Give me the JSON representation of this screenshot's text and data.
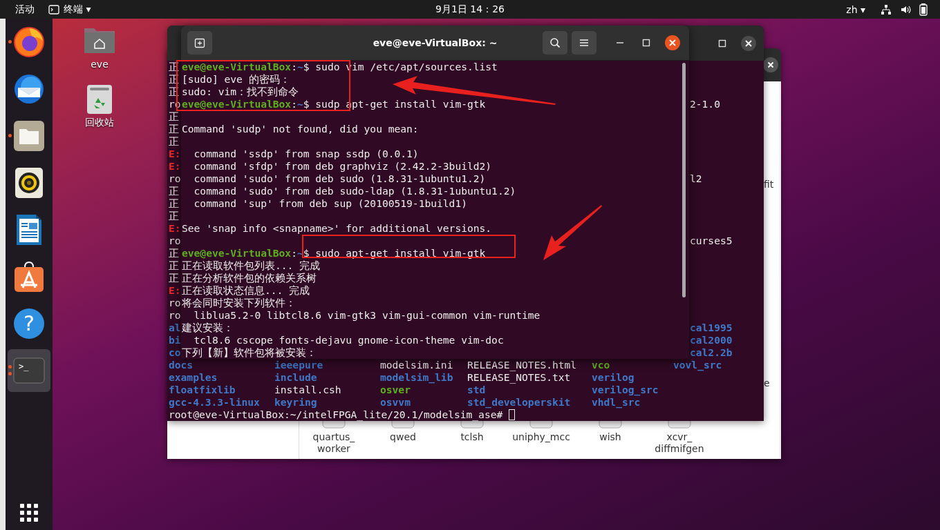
{
  "top_bar": {
    "activities": "活动",
    "app_menu": "终端",
    "app_menu_caret": "▾",
    "clock": "9月1日 14：26",
    "input_source": "zh",
    "input_source_caret": "▾"
  },
  "dock": {
    "items": [
      {
        "kind": "browser",
        "running": true,
        "multiple": false,
        "focused": false
      },
      {
        "kind": "mail",
        "running": false,
        "multiple": false,
        "focused": false
      },
      {
        "kind": "files",
        "running": true,
        "multiple": false,
        "focused": false
      },
      {
        "kind": "music",
        "running": false,
        "multiple": false,
        "focused": false
      },
      {
        "kind": "writer",
        "running": false,
        "multiple": false,
        "focused": false
      },
      {
        "kind": "software",
        "running": false,
        "multiple": false,
        "focused": false
      },
      {
        "kind": "help",
        "glyph": "?",
        "running": false,
        "multiple": false,
        "focused": false
      },
      {
        "kind": "terminal",
        "glyph": ">_",
        "running": true,
        "multiple": true,
        "focused": true
      }
    ]
  },
  "desktop_icons": [
    {
      "kind": "home",
      "label": "eve"
    },
    {
      "kind": "trash",
      "label": "回收站"
    }
  ],
  "file_manager": {
    "fragments": [
      "fit",
      "e"
    ],
    "items": [
      {
        "label": [
          "quartus_",
          "worker"
        ]
      },
      {
        "label": [
          "qwed"
        ]
      },
      {
        "label": [
          "tclsh"
        ]
      },
      {
        "label": [
          "uniphy_mcc"
        ]
      },
      {
        "label": [
          "wish"
        ]
      },
      {
        "label": [
          "xcvr_",
          "diffmifgen"
        ]
      }
    ]
  },
  "back_terminal": {
    "lines": [
      {
        "left": {
          "text": "正",
          "kind": "plain"
        }
      },
      {
        "left": {
          "text": "正",
          "kind": "plain"
        }
      },
      {
        "left": {
          "text": "正",
          "kind": "plain"
        }
      },
      {
        "left": {
          "text": "ro",
          "kind": "plain"
        },
        "right": {
          "text": "2-1.0",
          "kind": "plain"
        }
      },
      {
        "left": {
          "text": "正",
          "kind": "plain"
        }
      },
      {
        "left": {
          "text": "正",
          "kind": "plain"
        }
      },
      {
        "left": {
          "text": "正",
          "kind": "plain"
        }
      },
      {
        "left": {
          "text": "E:",
          "kind": "error"
        }
      },
      {
        "left": {
          "text": "E:",
          "kind": "error"
        }
      },
      {
        "left": {
          "text": "ro",
          "kind": "plain"
        },
        "right": {
          "text": "l2",
          "kind": "plain"
        }
      },
      {
        "left": {
          "text": "正",
          "kind": "plain"
        }
      },
      {
        "left": {
          "text": "正",
          "kind": "plain"
        }
      },
      {
        "left": {
          "text": "正",
          "kind": "plain"
        }
      },
      {
        "left": {
          "text": "E:",
          "kind": "error"
        }
      },
      {
        "left": {
          "text": "ro",
          "kind": "plain"
        },
        "right": {
          "text": "curses5",
          "kind": "plain"
        }
      },
      {
        "left": {
          "text": "正",
          "kind": "plain"
        }
      },
      {
        "left": {
          "text": "正",
          "kind": "plain"
        }
      },
      {
        "left": {
          "text": "正",
          "kind": "plain"
        }
      },
      {
        "left": {
          "text": "E:",
          "kind": "error"
        }
      },
      {
        "left": {
          "text": "ro",
          "kind": "plain"
        }
      },
      {
        "left": {
          "text": "ro",
          "kind": "plain"
        }
      },
      {
        "left": {
          "text": "al",
          "kind": "dir"
        },
        "right": {
          "text": "cal1995",
          "kind": "dir"
        }
      },
      {
        "left": {
          "text": "bi",
          "kind": "dir"
        },
        "right": {
          "text": "cal2000",
          "kind": "dir"
        }
      },
      {
        "left": {
          "text": "co",
          "kind": "dir"
        },
        "right": {
          "text": "cal2.2b",
          "kind": "dir"
        }
      }
    ],
    "listing": [
      [
        {
          "name": "docs",
          "kind": "dir"
        },
        {
          "name": "ieeepure",
          "kind": "dir"
        },
        {
          "name": "modelsim.ini",
          "kind": "file"
        },
        {
          "name": "RELEASE_NOTES.html",
          "kind": "file"
        },
        {
          "name": "vco",
          "kind": "exec"
        },
        {
          "name": "vovl_src",
          "kind": "dir"
        }
      ],
      [
        {
          "name": "examples",
          "kind": "dir"
        },
        {
          "name": "include",
          "kind": "dir"
        },
        {
          "name": "modelsim_lib",
          "kind": "dir"
        },
        {
          "name": "RELEASE_NOTES.txt",
          "kind": "file"
        },
        {
          "name": "verilog",
          "kind": "dir"
        }
      ],
      [
        {
          "name": "floatfixlib",
          "kind": "dir"
        },
        {
          "name": "install.csh",
          "kind": "file"
        },
        {
          "name": "osver",
          "kind": "exec"
        },
        {
          "name": "std",
          "kind": "dir"
        },
        {
          "name": "verilog_src",
          "kind": "dir"
        }
      ],
      [
        {
          "name": "gcc-4.3.3-linux",
          "kind": "dir"
        },
        {
          "name": "keyring",
          "kind": "dir"
        },
        {
          "name": "osvvm",
          "kind": "dir"
        },
        {
          "name": "std_developerskit",
          "kind": "dir"
        },
        {
          "name": "vhdl_src",
          "kind": "dir"
        }
      ]
    ],
    "prompt": {
      "text": "root@eve-VirtualBox:~/intelFPGA_lite/20.1/modelsim_ase#",
      "cursor": true
    }
  },
  "front_terminal": {
    "title": "eve@eve-VirtualBox: ~",
    "lines": [
      {
        "kind": "prompt",
        "user_host": "eve@eve-VirtualBox",
        "separator": ":",
        "path": "~",
        "command": "$ sudo vim /etc/apt/sources.list"
      },
      {
        "kind": "output",
        "text": "[sudo] eve 的密码："
      },
      {
        "kind": "output",
        "text": "sudo: vim：找不到命令"
      },
      {
        "kind": "prompt",
        "user_host": "eve@eve-VirtualBox",
        "separator": ":",
        "path": "~",
        "command": "$ sudp apt-get install vim-gtk"
      },
      {
        "kind": "blank"
      },
      {
        "kind": "output",
        "text": "Command 'sudp' not found, did you mean:"
      },
      {
        "kind": "blank"
      },
      {
        "kind": "output",
        "text": "  command 'ssdp' from snap ssdp (0.0.1)"
      },
      {
        "kind": "output",
        "text": "  command 'sfdp' from deb graphviz (2.42.2-3build2)"
      },
      {
        "kind": "output",
        "text": "  command 'sudo' from deb sudo (1.8.31-1ubuntu1.2)"
      },
      {
        "kind": "output",
        "text": "  command 'sudo' from deb sudo-ldap (1.8.31-1ubuntu1.2)"
      },
      {
        "kind": "output",
        "text": "  command 'sup' from deb sup (20100519-1build1)"
      },
      {
        "kind": "blank"
      },
      {
        "kind": "output",
        "text": "See 'snap info <snapname>' for additional versions."
      },
      {
        "kind": "blank"
      },
      {
        "kind": "prompt",
        "user_host": "eve@eve-VirtualBox",
        "separator": ":",
        "path": "~",
        "command": "$ sudo apt-get install vim-gtk"
      },
      {
        "kind": "output",
        "text": "正在读取软件包列表... 完成"
      },
      {
        "kind": "output",
        "text": "正在分析软件包的依赖关系树"
      },
      {
        "kind": "output",
        "text": "正在读取状态信息... 完成"
      },
      {
        "kind": "output",
        "text": "将会同时安装下列软件："
      },
      {
        "kind": "output",
        "text": "  liblua5.2-0 libtcl8.6 vim-gtk3 vim-gui-common vim-runtime"
      },
      {
        "kind": "output",
        "text": "建议安装："
      },
      {
        "kind": "output",
        "text": "  tcl8.6 cscope fonts-dejavu gnome-icon-theme vim-doc"
      },
      {
        "kind": "output",
        "text": "下列【新】软件包将被安装："
      }
    ]
  }
}
